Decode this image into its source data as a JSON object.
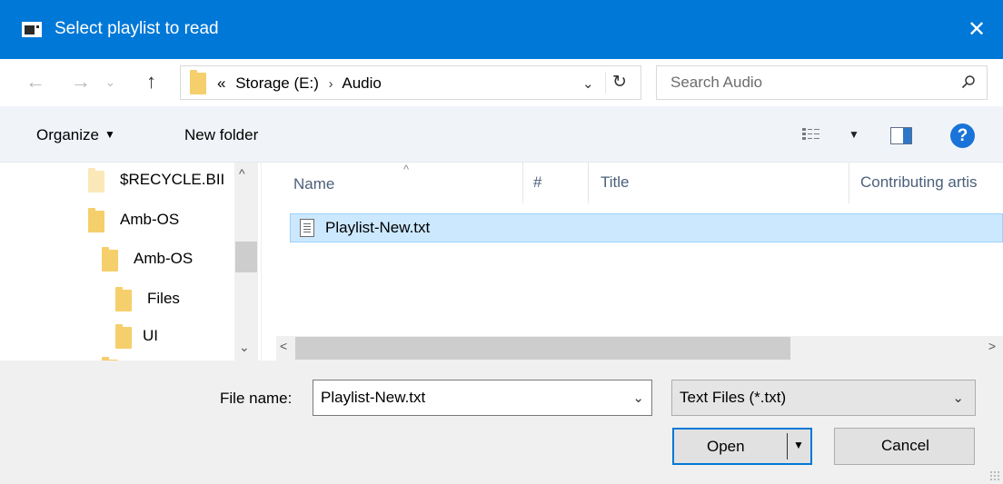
{
  "window": {
    "title": "Select playlist to read"
  },
  "address": {
    "prefix": "«",
    "crumbs": [
      "Storage (E:)",
      "Audio"
    ],
    "separator": "›"
  },
  "search": {
    "placeholder": "Search Audio"
  },
  "toolbar": {
    "organize": "Organize",
    "new_folder": "New folder"
  },
  "nav": {
    "items": [
      {
        "label": "$RECYCLE.BII",
        "pale": true
      },
      {
        "label": "Amb-OS",
        "pale": false
      },
      {
        "label": "Amb-OS",
        "pale": false
      },
      {
        "label": "Files",
        "pale": false
      },
      {
        "label": "UI",
        "pale": false
      }
    ]
  },
  "columns": {
    "name": "Name",
    "number": "#",
    "title": "Title",
    "artist": "Contributing artis"
  },
  "files": [
    {
      "name": "Playlist-New.txt",
      "selected": true
    }
  ],
  "footer": {
    "file_name_label": "File name:",
    "file_name_value": "Playlist-New.txt",
    "file_type": "Text Files (*.txt)",
    "open_label": "Open",
    "cancel_label": "Cancel"
  },
  "colors": {
    "titlebar": "#0078d7",
    "selection": "#cce8ff",
    "accent": "#0078d7"
  },
  "icons": [
    "app-icon",
    "close-icon",
    "back-arrow-icon",
    "forward-arrow-icon",
    "up-arrow-icon",
    "folder-icon",
    "refresh-icon",
    "search-icon",
    "view-options-icon",
    "preview-pane-icon",
    "help-icon",
    "text-file-icon"
  ]
}
